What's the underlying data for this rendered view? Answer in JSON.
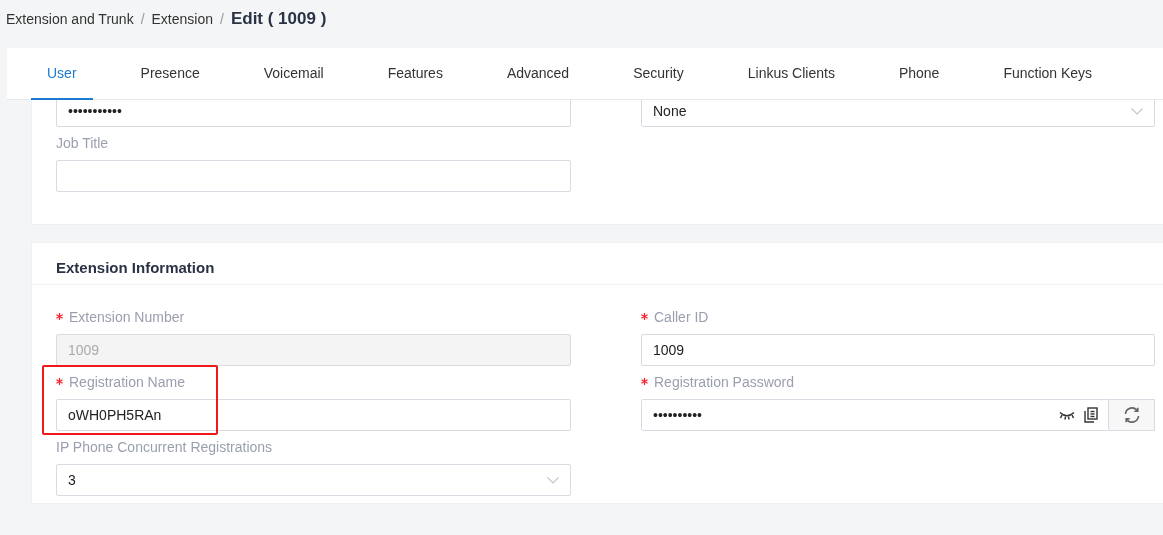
{
  "breadcrumb": {
    "separator": "/",
    "items": [
      "Extension and Trunk",
      "Extension"
    ],
    "current": "Edit ( 1009 )"
  },
  "tabs": [
    {
      "label": "User",
      "selected": true
    },
    {
      "label": "Presence",
      "selected": false
    },
    {
      "label": "Voicemail",
      "selected": false
    },
    {
      "label": "Features",
      "selected": false
    },
    {
      "label": "Advanced",
      "selected": false
    },
    {
      "label": "Security",
      "selected": false
    },
    {
      "label": "Linkus Clients",
      "selected": false
    },
    {
      "label": "Phone",
      "selected": false
    },
    {
      "label": "Function Keys",
      "selected": false
    }
  ],
  "cards": [
    {
      "rows": [
        [
          {
            "kind": "text",
            "value": "•••••••••••"
          },
          {
            "kind": "select",
            "value": "None"
          }
        ],
        [
          {
            "kind": "text",
            "label": "Job Title"
          }
        ]
      ]
    },
    {
      "title": "Extension Information",
      "rows": [
        [
          {
            "kind": "text",
            "label": "Extension Number",
            "required": true,
            "disabled": true,
            "value": "1009"
          },
          {
            "kind": "text",
            "label": "Caller ID",
            "required": true,
            "value": "1009"
          }
        ],
        [
          {
            "kind": "text",
            "label": "Registration Name",
            "required": true,
            "highlighted": true,
            "value": "oWH0PH5RAn"
          },
          {
            "kind": "password",
            "label": "Registration Password",
            "required": true,
            "value": "••••••••••"
          }
        ],
        [
          {
            "kind": "select",
            "label": "IP Phone Concurrent Registrations",
            "value": "3"
          }
        ]
      ]
    }
  ]
}
